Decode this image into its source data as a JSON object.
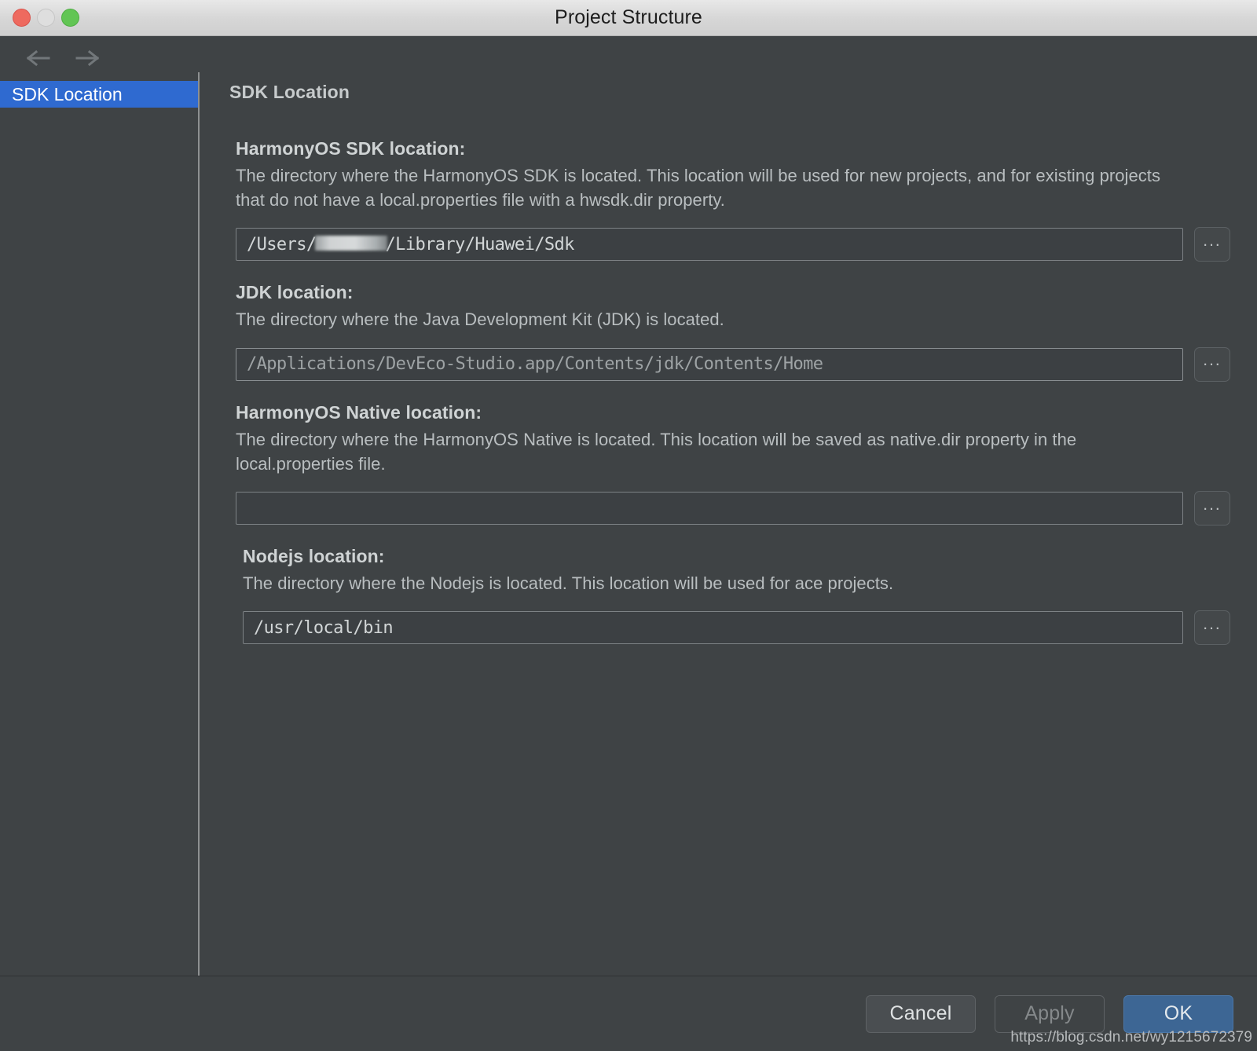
{
  "window": {
    "title": "Project Structure",
    "traffic_lights": [
      "close",
      "minimize",
      "zoom"
    ]
  },
  "sidebar": {
    "nav": {
      "back": "back-arrow",
      "forward": "forward-arrow"
    },
    "items": [
      {
        "label": "SDK Location",
        "selected": true
      }
    ]
  },
  "content": {
    "page_title": "SDK Location",
    "sections": [
      {
        "label": "HarmonyOS SDK location:",
        "description": "The directory where the HarmonyOS SDK is located. This location will be used for new projects, and for existing projects that do not have a local.properties file with a hwsdk.dir property.",
        "value_prefix": "/Users/",
        "value_redacted": true,
        "value_suffix": "/Library/Huawei/Sdk",
        "browse_label": "...",
        "disabled": false
      },
      {
        "label": "JDK location:",
        "description": "The directory where the Java Development Kit (JDK) is located.",
        "value": "/Applications/DevEco-Studio.app/Contents/jdk/Contents/Home",
        "browse_label": "...",
        "disabled": true
      },
      {
        "label": "HarmonyOS Native location:",
        "description": "The directory where the HarmonyOS Native is located. This location will be saved as native.dir property in the local.properties file.",
        "value": "",
        "browse_label": "...",
        "disabled": false
      },
      {
        "label": "Nodejs location:",
        "description": "The directory where the Nodejs is located. This location will be used for ace projects.",
        "value": "/usr/local/bin",
        "browse_label": "...",
        "disabled": false
      }
    ]
  },
  "footer": {
    "cancel_label": "Cancel",
    "apply_label": "Apply",
    "ok_label": "OK",
    "watermark": "https://blog.csdn.net/wy1215672379"
  },
  "colors": {
    "window_background": "#3f4345",
    "titlebar": "#d6d6d6",
    "accent_selection": "#2f6ad0",
    "ok_button": "#3d6694",
    "field_border": "#7d8285",
    "text_primary": "#cfd3d4",
    "text_secondary": "#b9bec0"
  }
}
